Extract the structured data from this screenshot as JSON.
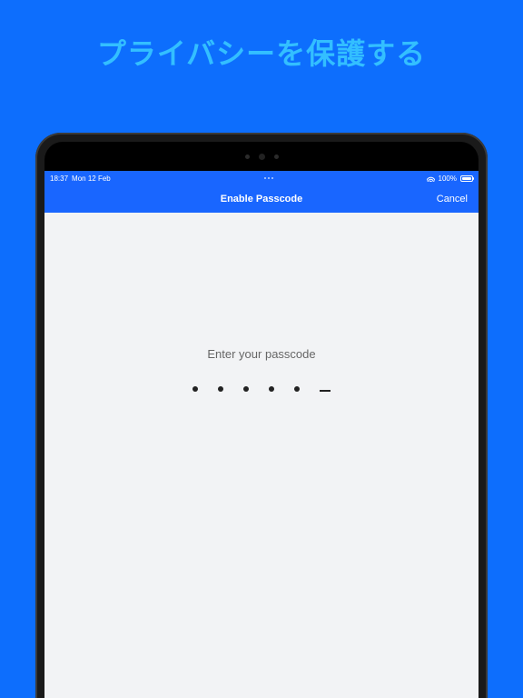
{
  "promo": {
    "title": "プライバシーを保護する"
  },
  "statusbar": {
    "time": "18:37",
    "date": "Mon 12 Feb",
    "battery_pct": "100%"
  },
  "navbar": {
    "title": "Enable Passcode",
    "cancel": "Cancel"
  },
  "passcode": {
    "prompt": "Enter your passcode",
    "total_digits": 6,
    "entered_digits": 5
  }
}
